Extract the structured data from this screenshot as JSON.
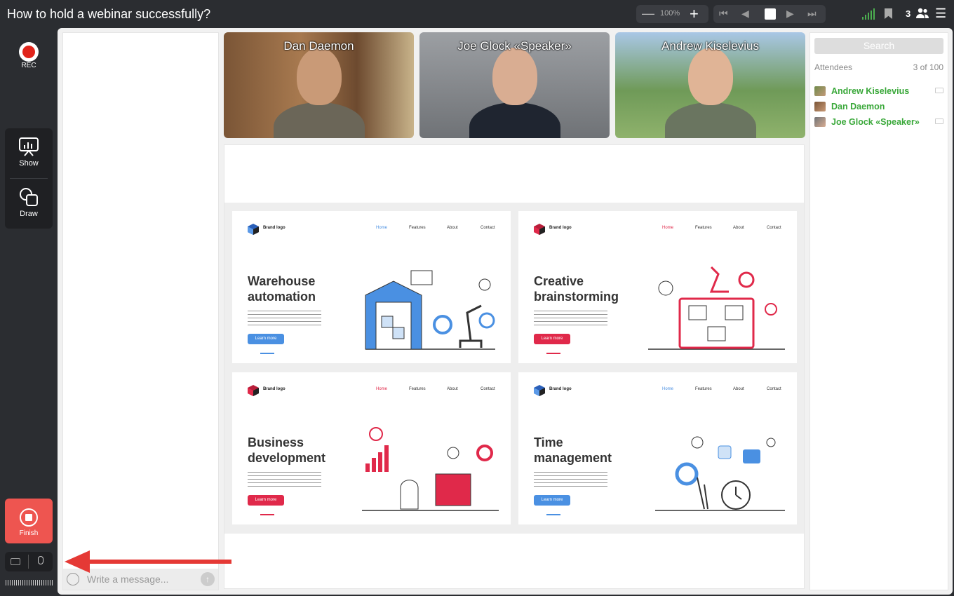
{
  "window": {
    "title": "How to hold a webinar successfully?"
  },
  "toolbar": {
    "zoom_minus": "—",
    "zoom_value": "100%",
    "zoom_plus": "+",
    "participant_count": "3",
    "icons": [
      "signal-icon",
      "bookmark-icon",
      "people-icon",
      "menu-icon",
      "first-page-icon",
      "prev-page-icon",
      "stop-icon",
      "next-page-icon",
      "last-page-icon"
    ]
  },
  "sidebar": {
    "rec_label": "REC",
    "show_label": "Show",
    "draw_label": "Draw",
    "finish_label": "Finish"
  },
  "chat": {
    "placeholder": "Write a message..."
  },
  "videos": [
    {
      "name": "Dan Daemon"
    },
    {
      "name": "Joe Glock «Speaker»"
    },
    {
      "name": "Andrew Kiselevius"
    }
  ],
  "slides": [
    {
      "brand": "Brand logo",
      "nav": [
        "Home",
        "Features",
        "About",
        "Contact"
      ],
      "heading_1": "Warehouse",
      "heading_2": "automation",
      "button": "Learn more",
      "accent": "#4a90e2"
    },
    {
      "brand": "Brand logo",
      "nav": [
        "Home",
        "Features",
        "About",
        "Contact"
      ],
      "heading_1": "Creative",
      "heading_2": "brainstorming",
      "button": "Learn more",
      "accent": "#e0294a"
    },
    {
      "brand": "Brand logo",
      "nav": [
        "Home",
        "Features",
        "About",
        "Contact"
      ],
      "heading_1": "Business",
      "heading_2": "development",
      "button": "Learn more",
      "accent": "#e0294a"
    },
    {
      "brand": "Brand logo",
      "nav": [
        "Home",
        "Features",
        "About",
        "Contact"
      ],
      "heading_1": "Time",
      "heading_2": "management",
      "button": "Learn more",
      "accent": "#4a90e2"
    }
  ],
  "attendees": {
    "search_label": "Search",
    "header": "Attendees",
    "count": "3 of 100",
    "list": [
      {
        "name": "Andrew Kiselevius"
      },
      {
        "name": "Dan Daemon"
      },
      {
        "name": "Joe Glock «Speaker»"
      }
    ]
  },
  "colors": {
    "accent_green": "#3aa83a",
    "finish_red": "#ee5550",
    "rec_red": "#e0241b",
    "arrow_red": "#e53935"
  }
}
